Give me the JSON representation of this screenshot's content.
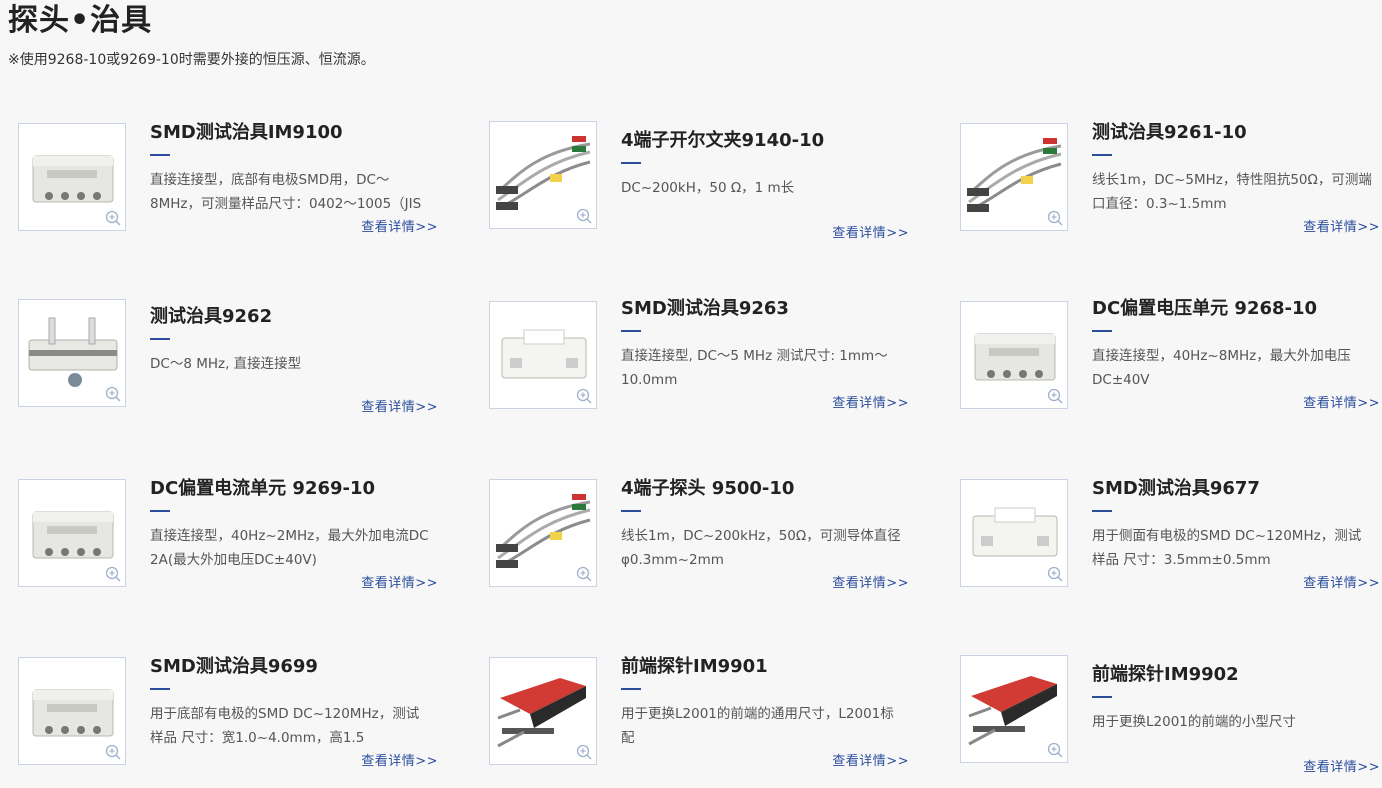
{
  "page": {
    "title": "探头•治具",
    "note": "※使用9268-10或9269-10时需要外接的恒压源、恒流源。"
  },
  "more_label": "查看详情>>",
  "accent_color": "#2b4d9c",
  "products": [
    {
      "name": "SMD测试治具IM9100",
      "desc": "直接连接型，底部有电极SMD用，DC～8MHz，可测量样品尺寸：0402～1005（JIS",
      "image": "smd-fixture-im9100-photo"
    },
    {
      "name": "4端子开尔文夹9140-10",
      "desc": "DC~200kH，50 Ω，1 m长",
      "image": "kelvin-clip-cable-photo"
    },
    {
      "name": "测试治具9261-10",
      "desc": "线长1m，DC~5MHz，特性阻抗50Ω，可测端口直径：0.3~1.5mm",
      "image": "fixture-9261-cable-photo"
    },
    {
      "name": "测试治具9262",
      "desc": "DC～8 MHz, 直接连接型",
      "image": "fixture-9262-photo"
    },
    {
      "name": "SMD测试治具9263",
      "desc": "直接连接型, DC～5 MHz 测试尺寸: 1mm～10.0mm",
      "image": "smd-fixture-9263-photo"
    },
    {
      "name": "DC偏置电压单元 9268-10",
      "desc": "直接连接型，40Hz~8MHz，最大外加电压DC±40V",
      "image": "dc-bias-voltage-unit-photo"
    },
    {
      "name": "DC偏置电流单元 9269-10",
      "desc": "直接连接型，40Hz~2MHz，最大外加电流DC 2A(最大外加电压DC±40V)",
      "image": "dc-bias-current-unit-photo"
    },
    {
      "name": "4端子探头 9500-10",
      "desc": "线长1m，DC~200kHz，50Ω，可测导体直径φ0.3mm~2mm",
      "image": "four-terminal-probe-photo"
    },
    {
      "name": "SMD测试治具9677",
      "desc": "用于侧面有电极的SMD DC~120MHz，测试样品 尺寸：3.5mm±0.5mm",
      "image": "smd-fixture-9677-photo"
    },
    {
      "name": "SMD测试治具9699",
      "desc": "用于底部有电极的SMD DC~120MHz，测试样品 尺寸：宽1.0~4.0mm，高1.5",
      "image": "smd-fixture-9699-photo"
    },
    {
      "name": "前端探针IM9901",
      "desc": "用于更换L2001的前端的通用尺寸，L2001标配",
      "image": "tip-probe-im9901-photo"
    },
    {
      "name": "前端探针IM9902",
      "desc": "用于更换L2001的前端的小型尺寸",
      "image": "tip-probe-im9902-photo"
    }
  ]
}
